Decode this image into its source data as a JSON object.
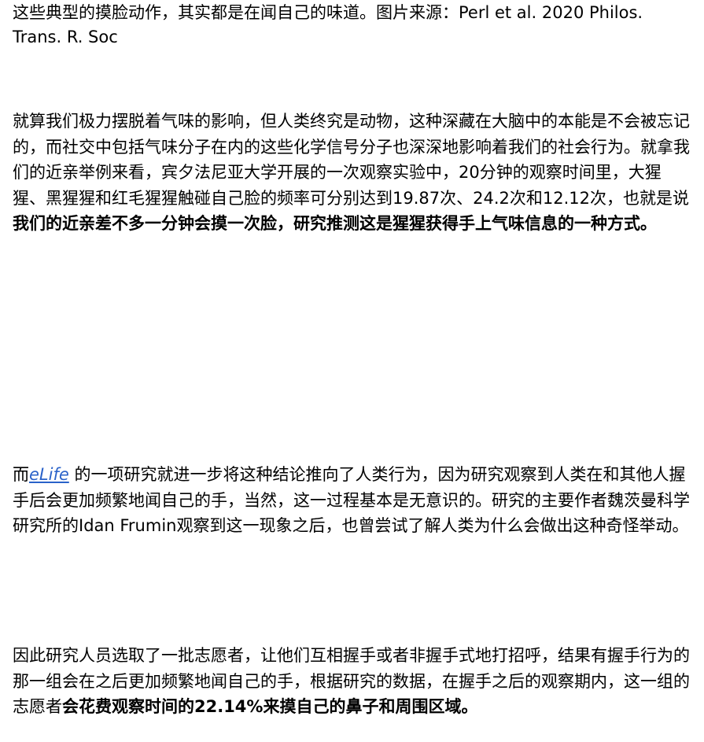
{
  "caption": "这些典型的摸脸动作，其实都是在闻自己的味道。图片来源：Perl et al. 2020 Philos. Trans. R. Soc",
  "paragraph1": {
    "text": "就算我们极力摆脱着气味的影响，但人类终究是动物，这种深藏在大脑中的本能是不会被忘记的，而社交中包括气味分子在内的这些化学信号分子也深深地影响着我们的社会行为。就拿我们的近亲举例来看，宾夕法尼亚大学开展的一次观察实验中，20分钟的观察时间里，大猩猩、黑猩猩和红毛猩猩触碰自己脸的频率可分别达到19.87次、24.2次和12.12次，也就是说",
    "bold": "我们的近亲差不多一分钟会摸一次脸，研究推测这是猩猩获得手上气味信息的一种方式。"
  },
  "paragraph2": {
    "prefix": "而",
    "link": "eLife",
    "text": " 的一项研究就进一步将这种结论推向了人类行为，因为研究观察到人类在和其他人握手后会更加频繁地闻自己的手，当然，这一过程基本是无意识的。研究的主要作者魏茨曼科学研究所的Idan Frumin观察到这一现象之后，也曾尝试了解人类为什么会做出这种奇怪举动。"
  },
  "paragraph3": {
    "text": "因此研究人员选取了一批志愿者，让他们互相握手或者非握手式地打招呼，结果有握手行为的那一组会在之后更加频繁地闻自己的手，根据研究的数据，在握手之后的观察期内，这一组的志愿者",
    "bold": "会花费观察时间的22.14%来摸自己的鼻子和周围区域。"
  },
  "colors": {
    "link": "#2a62c9",
    "text": "#000000",
    "background": "#ffffff"
  }
}
